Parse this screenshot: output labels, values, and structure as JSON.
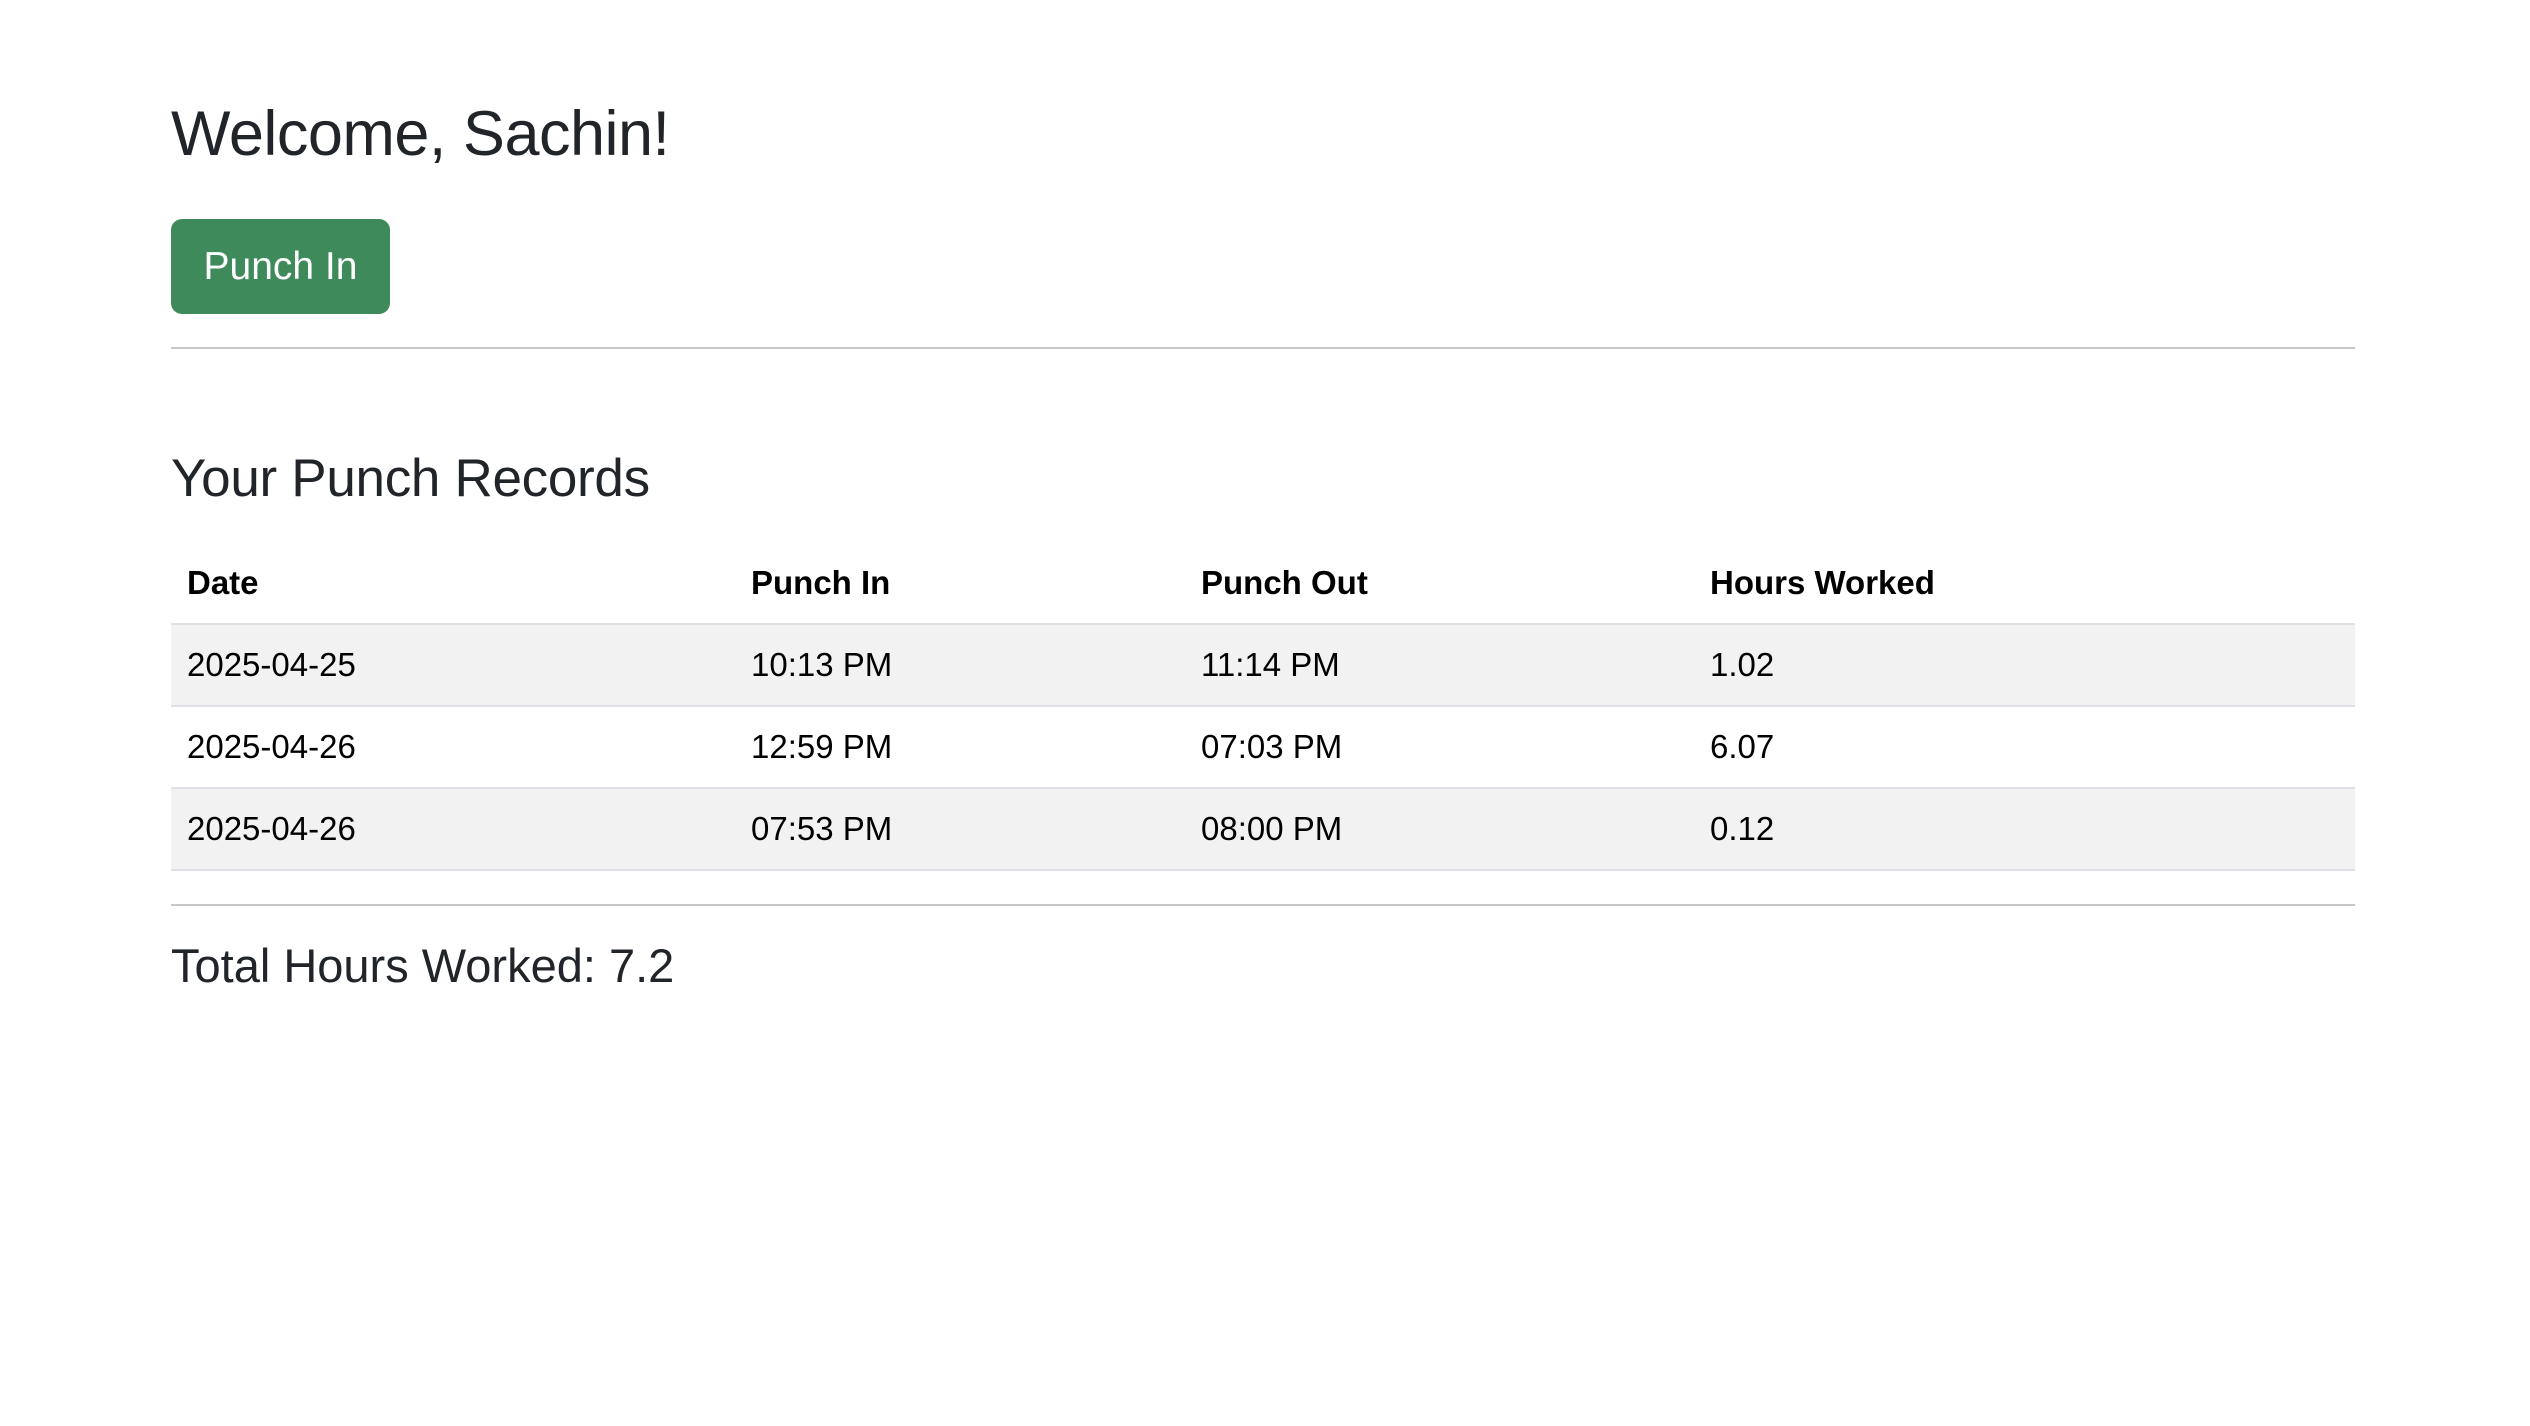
{
  "welcome": {
    "title": "Welcome, Sachin!"
  },
  "actions": {
    "punch_button_label": "Punch In",
    "punch_button_color": "#3f8a5b"
  },
  "records": {
    "title": "Your Punch Records",
    "columns": [
      "Date",
      "Punch In",
      "Punch Out",
      "Hours Worked"
    ],
    "rows": [
      [
        "2025-04-25",
        "10:13 PM",
        "11:14 PM",
        "1.02"
      ],
      [
        "2025-04-26",
        "12:59 PM",
        "07:03 PM",
        "6.07"
      ],
      [
        "2025-04-26",
        "07:53 PM",
        "08:00 PM",
        "0.12"
      ]
    ]
  },
  "summary": {
    "total_label": "Total Hours Worked: 7.2"
  }
}
